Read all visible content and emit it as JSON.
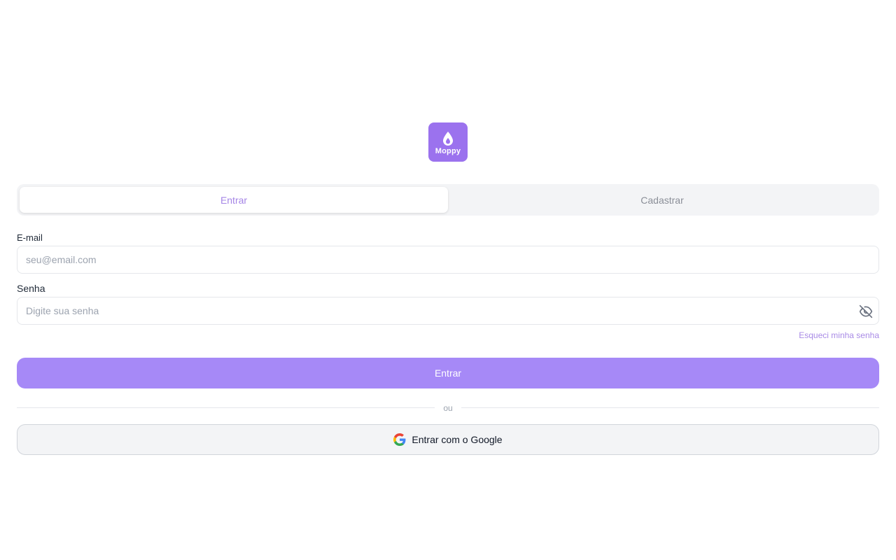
{
  "logo": {
    "text": "Moppy",
    "color": "#9b72ee",
    "icon": "droplet-icon"
  },
  "tabs": [
    {
      "label": "Entrar",
      "active": true
    },
    {
      "label": "Cadastrar",
      "active": false
    }
  ],
  "form": {
    "email_label": "E-mail",
    "email_placeholder": "seu@email.com",
    "email_value": "",
    "password_label": "Senha",
    "password_placeholder": "Digite sua senha",
    "password_value": "",
    "password_toggle_icon": "eye-off-icon",
    "forgot_label": "Esqueci minha senha",
    "submit_label": "Entrar"
  },
  "divider": {
    "label": "ou"
  },
  "google": {
    "label": "Entrar com o Google",
    "icon": "google-icon"
  },
  "colors": {
    "accent": "#a689f7",
    "accent_text": "#a585e6",
    "tab_bg": "#f3f4f6"
  }
}
